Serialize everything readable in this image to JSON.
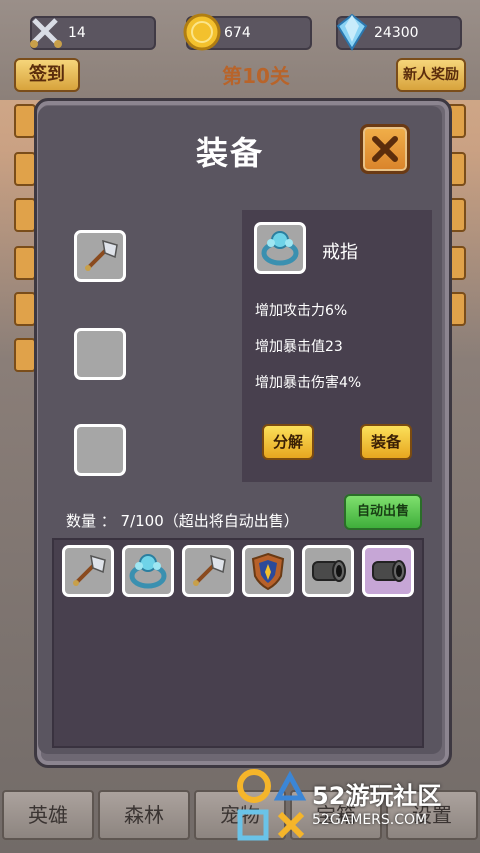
{
  "resources": {
    "attack_value": "14",
    "coins_value": "674",
    "gems_value": "24300"
  },
  "header": {
    "signin_label": "签到",
    "stage_label": "第10关",
    "newbie_reward_label": "新人奖励"
  },
  "modal": {
    "title": "装备",
    "selected_item": {
      "name": "戒指",
      "stats": [
        "增加攻击力6%",
        "增加暴击值23",
        "增加暴击伤害4%"
      ],
      "decompose_label": "分解",
      "equip_label": "装备"
    },
    "count_text": "数量 ： 7/100（超出将自动出售）",
    "auto_sell_label": "自动出售",
    "inventory": [
      "axe-icon",
      "ring-icon",
      "axe-icon",
      "shield-icon",
      "cannon-icon",
      "cannon-icon"
    ]
  },
  "bottom_nav": [
    "英雄",
    "森林",
    "宠物",
    "宝箱",
    "设置"
  ],
  "watermark": {
    "brand": "52游玩社区",
    "site": "52GAMERS.COM"
  },
  "colors": {
    "button_gold": "#e7a61f",
    "button_green": "#3fae3b",
    "panel": "#5a5560",
    "slot": "#a6a6a6"
  }
}
